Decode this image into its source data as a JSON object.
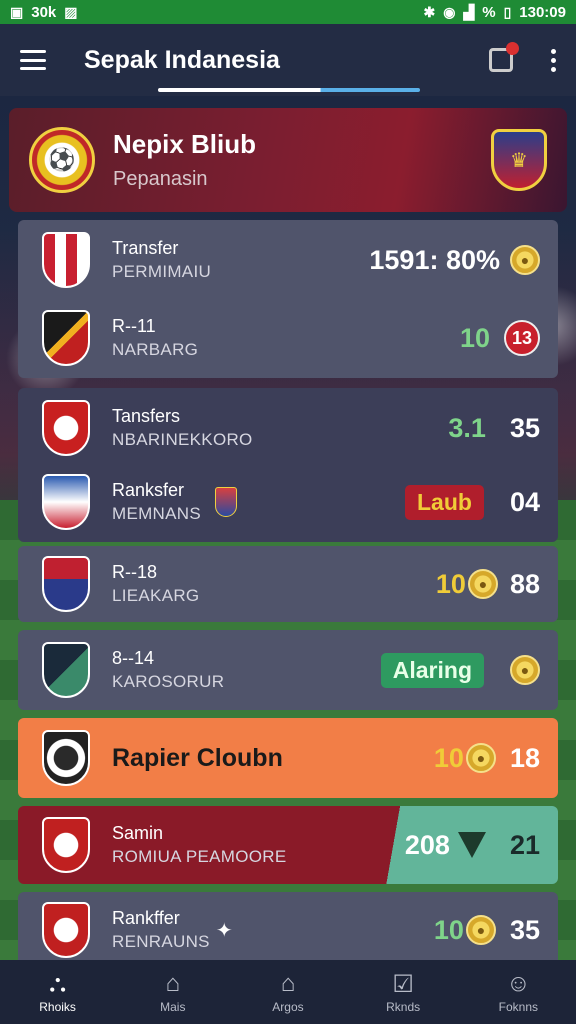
{
  "status_bar": {
    "left_text": "30k",
    "time": "130:09",
    "battery": "%"
  },
  "app_bar": {
    "title": "Sepak Indanesia"
  },
  "club_header": {
    "title": "Nepix Bliub",
    "subtitle": "Pepanasin"
  },
  "rows": [
    {
      "name": "Transfer",
      "sub": "PERMIMAIU",
      "score": "1591: 80%"
    },
    {
      "name": "R--11",
      "sub": "NARBARG",
      "score": "10",
      "badge": "13"
    },
    {
      "name": "Tansfers",
      "sub": "NBARINEKKORO",
      "score": "3.1",
      "score2": "35"
    },
    {
      "name": "Ranksfer",
      "sub": "MEMNANS",
      "pill": "Laub",
      "score": "04"
    },
    {
      "name": "R--18",
      "sub": "LIEAKARG",
      "score": "10",
      "score2": "88"
    },
    {
      "name": "8--14",
      "sub": "KAROSORUR",
      "pill": "Alaring"
    },
    {
      "name": "Rapier Cloubn",
      "score": "10",
      "score2": "18"
    },
    {
      "name": "Samin",
      "sub": "ROMIUA PEAMOORE",
      "score": "208",
      "score2": "21"
    },
    {
      "name": "Rankffer",
      "sub": "RENRAUNS",
      "score": "10",
      "score2": "35"
    }
  ],
  "bottom_nav": [
    {
      "label": "Rhoiks",
      "icon": "home-alt-icon"
    },
    {
      "label": "Mais",
      "icon": "house-icon"
    },
    {
      "label": "Argos",
      "icon": "home-outline-icon"
    },
    {
      "label": "Rknds",
      "icon": "inbox-icon"
    },
    {
      "label": "Foknns",
      "icon": "profile-icon"
    }
  ],
  "colors": {
    "accent": "#f27e47",
    "status_bar": "#1f8b35",
    "app_bar": "#232c44",
    "header": "#7a1e30"
  }
}
